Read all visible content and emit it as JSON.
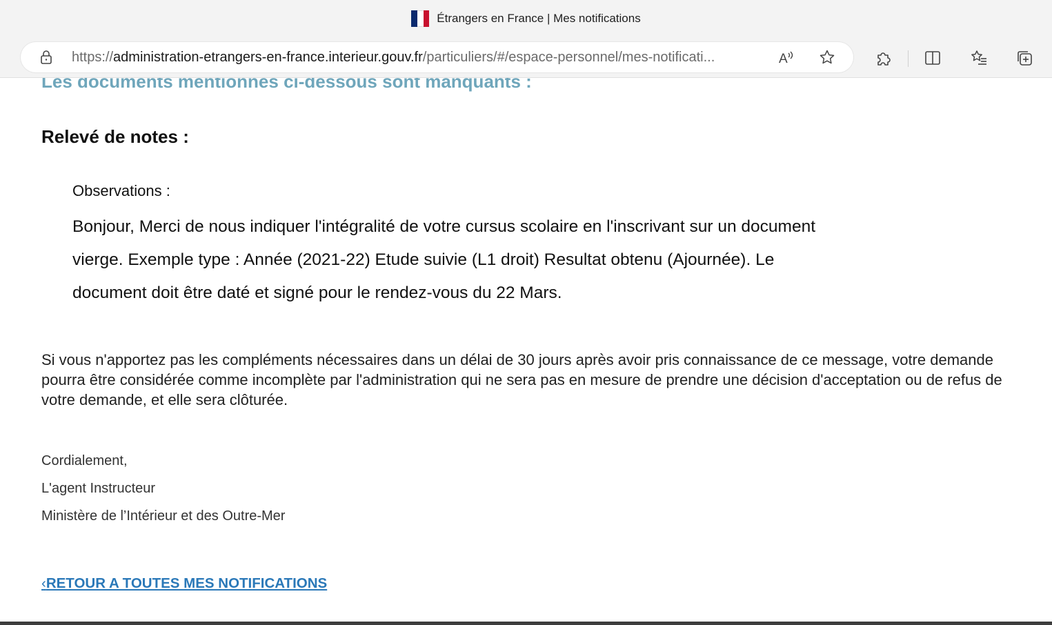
{
  "browser": {
    "tab_title": "Étrangers en France | Mes notifications",
    "url_prefix": "https://",
    "url_host": "administration-etrangers-en-france.interieur.gouv.fr",
    "url_path": "/particuliers/#/espace-personnel/mes-notificati..."
  },
  "notification": {
    "missing_heading": "Les documents mentionnés ci-dessous sont manquants :",
    "document_title": "Relevé de notes :",
    "observations_label": "Observations :",
    "observations_text": "Bonjour, Merci de nous indiquer l'intégralité de votre cursus scolaire en l'inscrivant sur un document vierge. Exemple type : Année (2021-22) Etude suivie (L1 droit) Resultat obtenu (Ajournée). Le document doit être daté et signé pour le rendez-vous du 22 Mars.",
    "notice": "Si vous n'apportez pas les compléments nécessaires dans un délai de 30 jours après avoir pris connaissance de ce message, votre demande pourra être considérée comme incomplète par l'administration qui ne sera pas en mesure de prendre une décision d'acceptation ou de refus de votre demande, et elle sera clôturée.",
    "closing": "Cordialement,",
    "signatory": "L'agent Instructeur",
    "ministry": "Ministère de l’Intérieur et des Outre-Mer",
    "back_link": "RETOUR A TOUTES MES NOTIFICATIONS"
  },
  "icons": {
    "site": "french-flag-icon",
    "lock": "lock-icon",
    "read_aloud": "read-aloud-icon",
    "favorite": "star-icon",
    "extensions": "puzzle-icon",
    "split_screen": "split-screen-icon",
    "favorites": "favorites-list-icon",
    "collections": "collections-icon"
  },
  "colors": {
    "missing_heading": "#6fa6bb",
    "link": "#2a78b8",
    "chrome": "#f3f3f3"
  }
}
